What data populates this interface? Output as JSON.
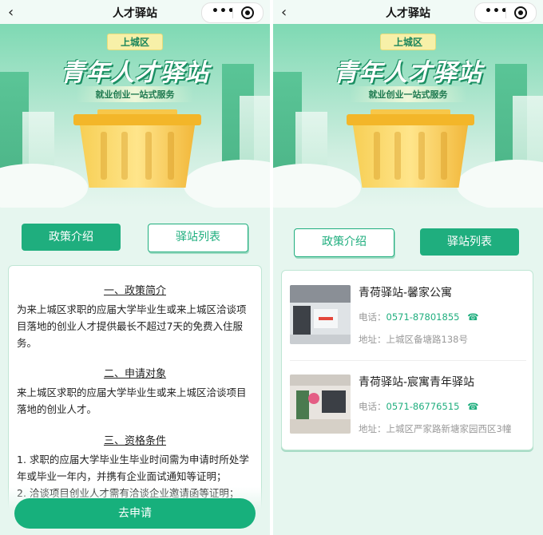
{
  "nav": {
    "back_icon": "chevron-left-icon",
    "title": "人才驿站",
    "menu_icon": "more-dots-icon",
    "close_icon": "record-circle-icon"
  },
  "banner": {
    "district_tag": "上城区",
    "title": "青年人才驿站",
    "subtitle": "就业创业一站式服务"
  },
  "tabs": {
    "policy": "政策介绍",
    "stations": "驿站列表"
  },
  "policy": {
    "sections": [
      {
        "heading": "一、政策简介",
        "body": "为来上城区求职的应届大学毕业生或来上城区洽谈项目落地的创业人才提供最长不超过7天的免费入住服务。"
      },
      {
        "heading": "二、申请对象",
        "body": "来上城区求职的应届大学毕业生或来上城区洽谈项目落地的创业人才。"
      },
      {
        "heading": "三、资格条件",
        "body": "1.  求职的应届大学毕业生毕业时间需为申请时所处学年或毕业一年内，并携有企业面试通知等证明；\n2.  洽谈项目创业人才需有洽谈企业邀请函等证明；"
      }
    ],
    "apply_label": "去申请"
  },
  "stations": {
    "phone_label": "电话：",
    "address_label": "地址：",
    "phone_icon": "phone-icon",
    "items": [
      {
        "name": "青荷驿站-馨家公寓",
        "phone": "0571-87801855",
        "address": "上城区备塘路138号"
      },
      {
        "name": "青荷驿站-宸寓青年驿站",
        "phone": "0571-86776515",
        "address": "上城区严家路新塘家园西区3幢"
      }
    ]
  },
  "colors": {
    "primary": "#1fae7e",
    "bg": "#e6f6ef"
  }
}
